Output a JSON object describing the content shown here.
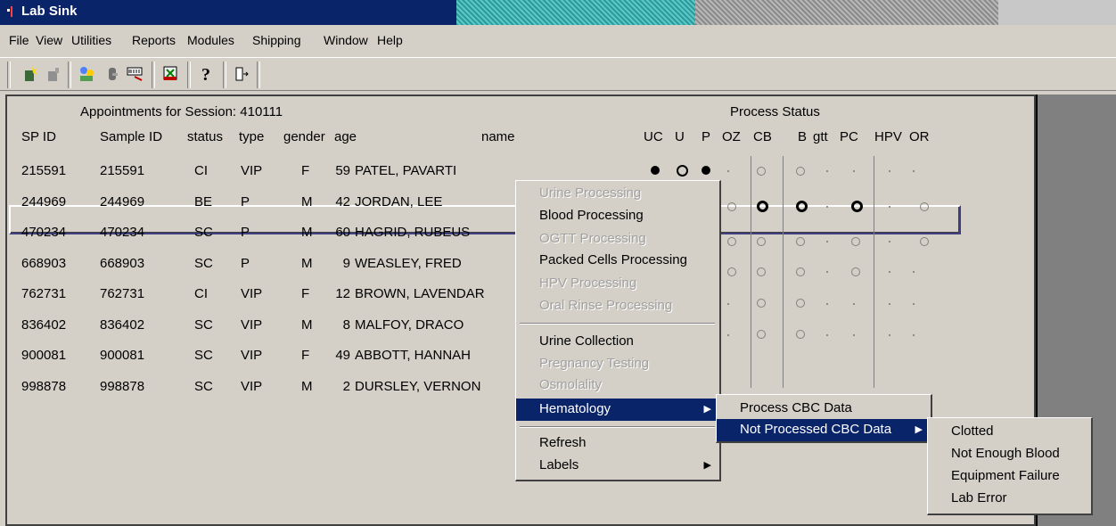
{
  "window": {
    "title": "Lab Sink"
  },
  "menubar": [
    {
      "label": "File"
    },
    {
      "label": "View"
    },
    {
      "label": "Utilities"
    },
    {
      "label": "Reports"
    },
    {
      "label": "Modules"
    },
    {
      "label": "Shipping"
    },
    {
      "label": "Window"
    },
    {
      "label": "Help"
    }
  ],
  "toolbar": {
    "icons": [
      "new-icon",
      "open-icon",
      "people-icon",
      "tube-icon",
      "barcode-icon",
      "flask-icon",
      "help-icon",
      "exit-icon"
    ]
  },
  "table": {
    "session_label": "Appointments for Session: 410111",
    "process_status_label": "Process Status",
    "headers": {
      "sp_id": "SP ID",
      "sample_id": "Sample ID",
      "status": "status",
      "type": "type",
      "gender": "gender",
      "age": "age",
      "name": "name",
      "uc": "UC",
      "u": "U",
      "p": "P",
      "oz": "OZ",
      "cb": "CB",
      "b": "B",
      "gtt": "gtt",
      "pc": "PC",
      "hpv": "HPV",
      "or": "OR"
    },
    "rows": [
      {
        "sp_id": "215591",
        "sample_id": "215591",
        "status": "CI",
        "type": "VIP",
        "gender": "F",
        "age": "59",
        "name": "PATEL, PAVARTI"
      },
      {
        "sp_id": "244969",
        "sample_id": "244969",
        "status": "BE",
        "type": "P",
        "gender": "M",
        "age": "42",
        "name": "JORDAN, LEE"
      },
      {
        "sp_id": "470234",
        "sample_id": "470234",
        "status": "SC",
        "type": "P",
        "gender": "M",
        "age": "60",
        "name": "HAGRID, RUBEUS"
      },
      {
        "sp_id": "668903",
        "sample_id": "668903",
        "status": "SC",
        "type": "P",
        "gender": "M",
        "age": "9",
        "name": "WEASLEY, FRED"
      },
      {
        "sp_id": "762731",
        "sample_id": "762731",
        "status": "CI",
        "type": "VIP",
        "gender": "F",
        "age": "12",
        "name": "BROWN, LAVENDAR"
      },
      {
        "sp_id": "836402",
        "sample_id": "836402",
        "status": "SC",
        "type": "VIP",
        "gender": "M",
        "age": "8",
        "name": "MALFOY, DRACO"
      },
      {
        "sp_id": "900081",
        "sample_id": "900081",
        "status": "SC",
        "type": "VIP",
        "gender": "F",
        "age": "49",
        "name": "ABBOTT, HANNAH"
      },
      {
        "sp_id": "998878",
        "sample_id": "998878",
        "status": "SC",
        "type": "VIP",
        "gender": "M",
        "age": "2",
        "name": "DURSLEY, VERNON"
      }
    ]
  },
  "context_menu": {
    "items": [
      {
        "label": "Urine Processing",
        "enabled": false
      },
      {
        "label": "Blood Processing",
        "enabled": true
      },
      {
        "label": "OGTT Processing",
        "enabled": false
      },
      {
        "label": "Packed Cells Processing",
        "enabled": true
      },
      {
        "label": "HPV Processing",
        "enabled": false
      },
      {
        "label": "Oral Rinse Processing",
        "enabled": false
      },
      {
        "label": "Urine Collection",
        "enabled": true
      },
      {
        "label": "Pregnancy Testing",
        "enabled": false
      },
      {
        "label": "Osmolality",
        "enabled": false
      },
      {
        "label": "Hematology",
        "enabled": true
      },
      {
        "label": "Refresh",
        "enabled": true
      },
      {
        "label": "Labels",
        "enabled": true
      }
    ]
  },
  "hematology_submenu": {
    "items": [
      {
        "label": "Process CBC Data"
      },
      {
        "label": "Not Processed CBC Data"
      }
    ]
  },
  "not_processed_submenu": {
    "items": [
      {
        "label": "Clotted"
      },
      {
        "label": "Not Enough Blood"
      },
      {
        "label": "Equipment Failure"
      },
      {
        "label": "Lab Error"
      }
    ]
  },
  "colors": {
    "titlebar": "#0a246a",
    "highlight": "#0a246a",
    "face": "#d4d0c8"
  }
}
